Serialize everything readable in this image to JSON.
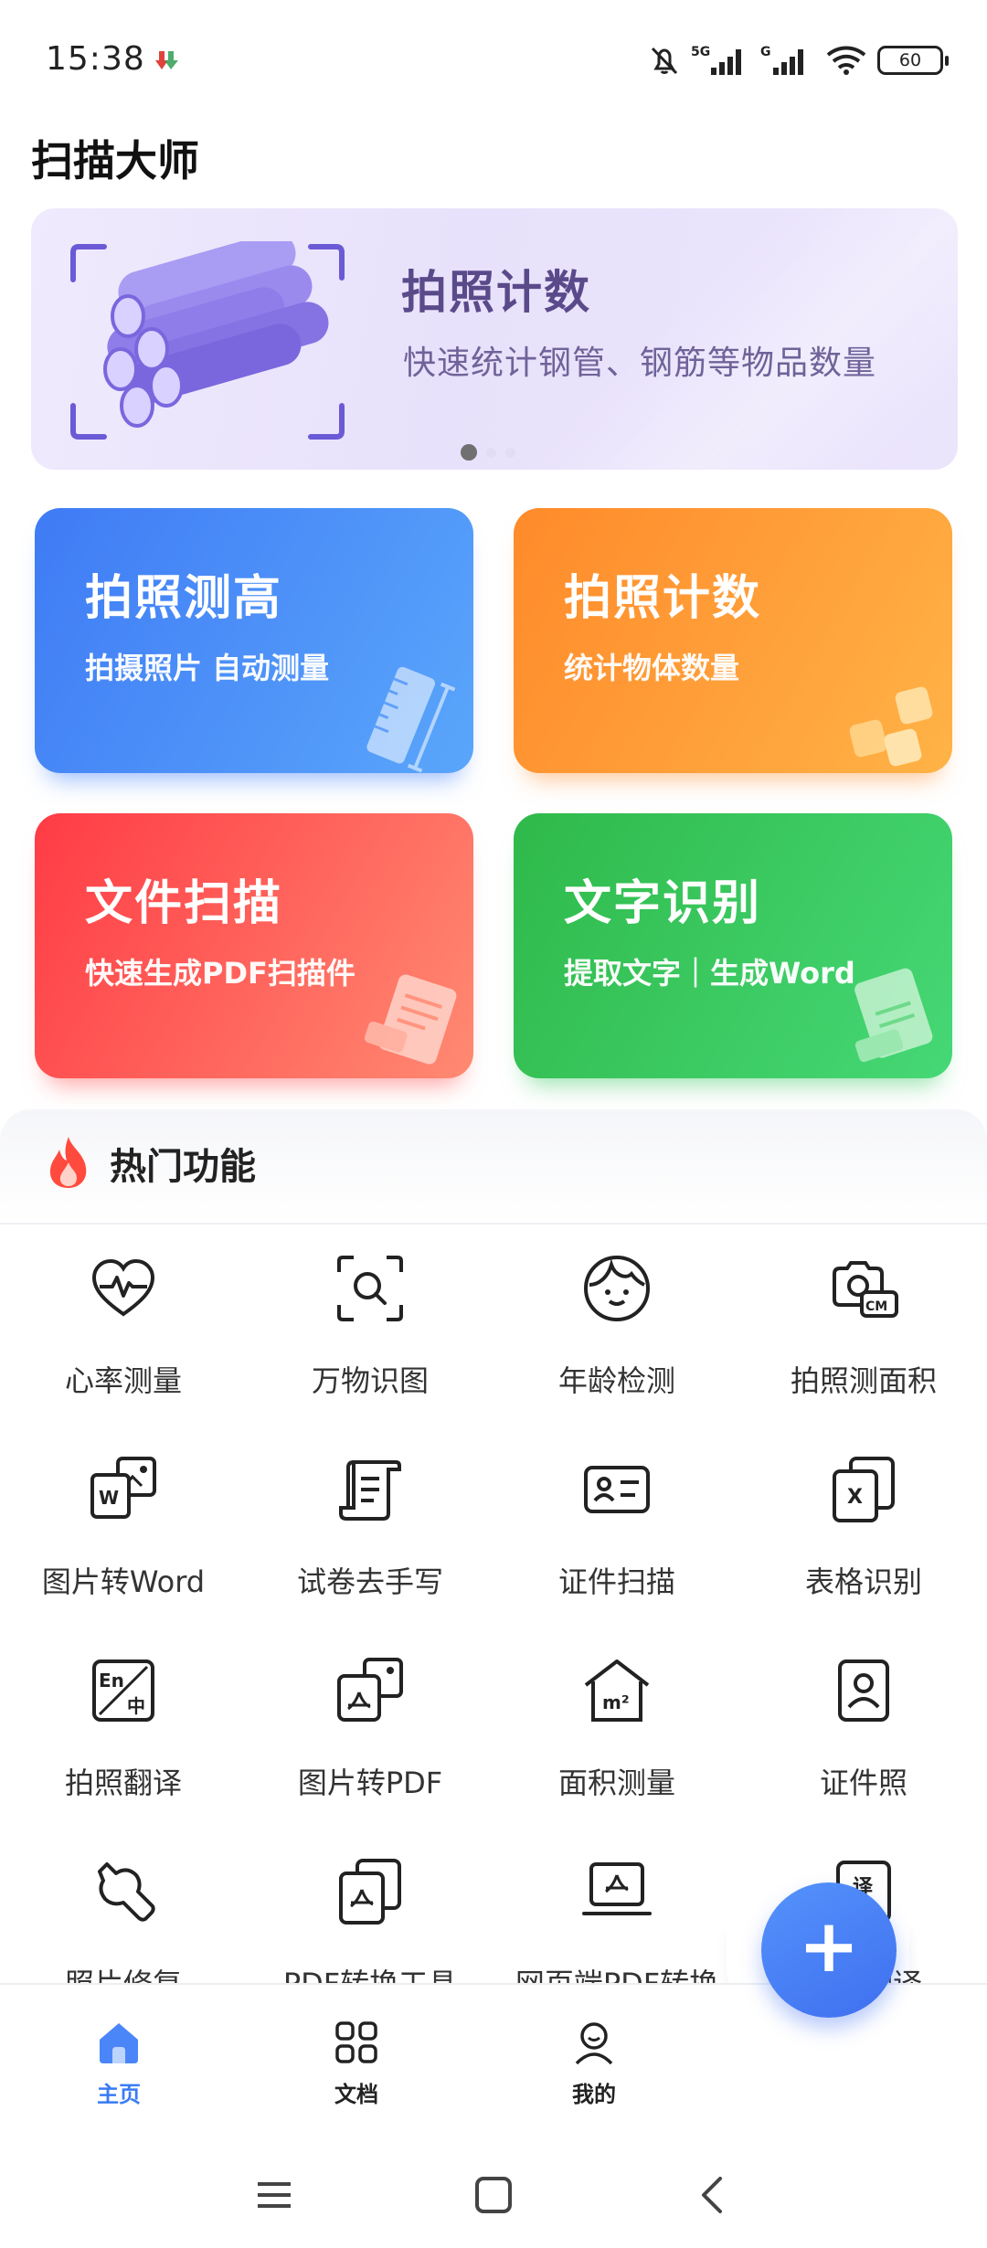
{
  "status_bar": {
    "time": "15:38",
    "battery": "60",
    "network_5g": "5G",
    "network_g": "G"
  },
  "app": {
    "title": "扫描大师"
  },
  "banner": {
    "title": "拍照计数",
    "subtitle": "快速统计钢管、钢筋等物品数量",
    "dots": 3,
    "active_dot": 0
  },
  "cards": [
    {
      "title": "拍照测高",
      "subtitle": "拍摄照片 自动测量",
      "icon": "ruler-icon"
    },
    {
      "title": "拍照计数",
      "subtitle": "统计物体数量",
      "icon": "number-blocks-icon"
    },
    {
      "title": "文件扫描",
      "subtitle": "快速生成PDF扫描件",
      "icon": "pdf-document-icon"
    },
    {
      "title": "文字识别",
      "subtitle": "提取文字｜生成Word",
      "icon": "ocr-word-icon"
    }
  ],
  "hot_section": {
    "title": "热门功能",
    "items": [
      {
        "label": "心率测量",
        "icon": "heart-rate-icon"
      },
      {
        "label": "万物识图",
        "icon": "scan-search-icon"
      },
      {
        "label": "年龄检测",
        "icon": "face-icon"
      },
      {
        "label": "拍照测面积",
        "icon": "camera-area-icon"
      },
      {
        "label": "图片转Word",
        "icon": "image-to-word-icon"
      },
      {
        "label": "试卷去手写",
        "icon": "paper-scroll-icon"
      },
      {
        "label": "证件扫描",
        "icon": "id-card-icon"
      },
      {
        "label": "表格识别",
        "icon": "excel-icon"
      },
      {
        "label": "拍照翻译",
        "icon": "translate-en-icon"
      },
      {
        "label": "图片转PDF",
        "icon": "image-to-pdf-icon"
      },
      {
        "label": "面积测量",
        "icon": "house-area-icon"
      },
      {
        "label": "证件照",
        "icon": "id-photo-icon"
      },
      {
        "label": "照片修复",
        "icon": "wrench-icon"
      },
      {
        "label": "PDF转换工具",
        "icon": "pdf-convert-icon"
      },
      {
        "label": "网页端PDF转换",
        "icon": "laptop-pdf-icon"
      },
      {
        "label": "文档翻译",
        "icon": "translate-doc-icon"
      }
    ]
  },
  "bottom_nav": {
    "items": [
      {
        "label": "主页",
        "icon": "home-icon",
        "active": true
      },
      {
        "label": "文档",
        "icon": "grid-icon",
        "active": false
      },
      {
        "label": "我的",
        "icon": "user-icon",
        "active": false
      }
    ],
    "fab_label": "+"
  },
  "colors": {
    "accent": "#3f7bf5",
    "card_blue": "#3f7bf5",
    "card_orange": "#ff8a2a",
    "card_red": "#ff3b45",
    "card_green": "#2fb94a",
    "banner_text": "#5a4a8a"
  }
}
